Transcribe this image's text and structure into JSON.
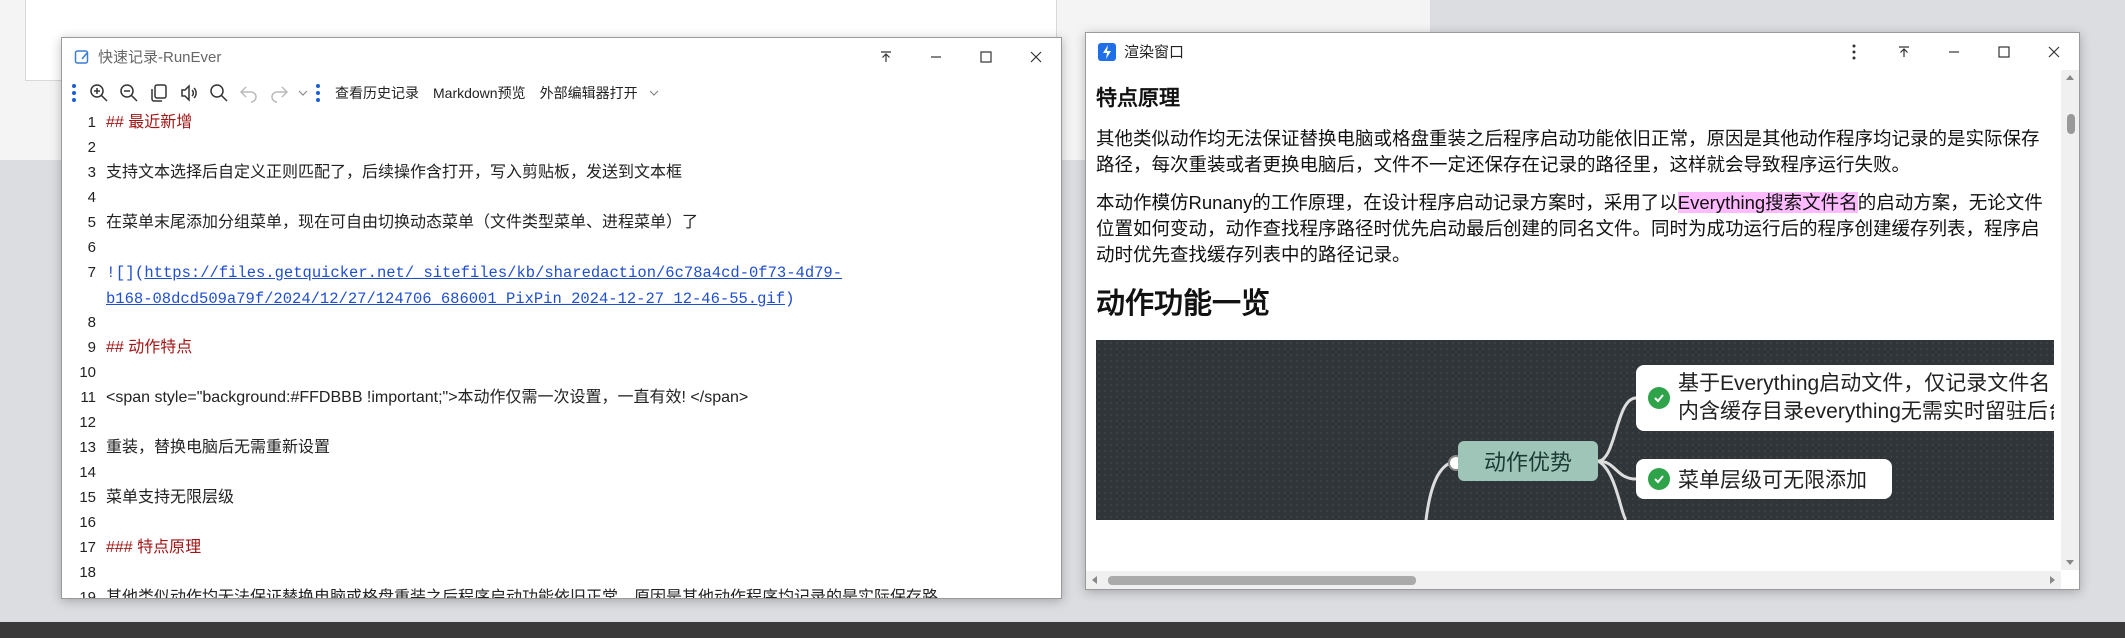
{
  "editor": {
    "title": "快速记录-RunEver",
    "toolbar": {
      "history_label": "查看历史记录",
      "preview_label": "Markdown预览",
      "external_label": "外部编辑器打开"
    },
    "lines": [
      {
        "n": "1",
        "text": "## 最近新增"
      },
      {
        "n": "2",
        "text": ""
      },
      {
        "n": "3",
        "text": "支持文本选择后自定义正则匹配了，后续操作含打开，写入剪贴板，发送到文本框"
      },
      {
        "n": "4",
        "text": ""
      },
      {
        "n": "5",
        "text": "在菜单末尾添加分组菜单，现在可自由切换动态菜单（文件类型菜单、进程菜单）了"
      },
      {
        "n": "6",
        "text": ""
      },
      {
        "n": "7",
        "prefix": "![](",
        "url1": "https://files.getquicker.net/_sitefiles/kb/sharedaction/6c78a4cd-0f73-4d79-",
        "url2": "b168-08dcd509a79f/2024/12/27/124706_686001_PixPin_2024-12-27_12-46-55.gif",
        "suffix": ")"
      },
      {
        "n": "8",
        "text": ""
      },
      {
        "n": "9",
        "text": "## 动作特点"
      },
      {
        "n": "10",
        "text": ""
      },
      {
        "n": "11",
        "text": "<span style=\"background:#FFDBBB !important;\">本动作仅需一次设置，一直有效! </span>"
      },
      {
        "n": "12",
        "text": ""
      },
      {
        "n": "13",
        "text": "重装，替换电脑后无需重新设置"
      },
      {
        "n": "14",
        "text": ""
      },
      {
        "n": "15",
        "text": "菜单支持无限层级"
      },
      {
        "n": "16",
        "text": ""
      },
      {
        "n": "17",
        "text": "### 特点原理"
      },
      {
        "n": "18",
        "text": ""
      },
      {
        "n": "19",
        "text": "其他类似动作均无法保证替换电脑或格盘重装之后程序启动功能依旧正常，原因是其他动作程序均记录的是实际保存路"
      }
    ]
  },
  "render": {
    "title": "渲染窗口",
    "h3": "特点原理",
    "p1": "其他类似动作均无法保证替换电脑或格盘重装之后程序启动功能依旧正常，原因是其他动作程序均记录的是实际保存路径，每次重装或者更换电脑后，文件不一定还保存在记录的路径里，这样就会导致程序运行失败。",
    "p2_before": "本动作模仿Runany的工作原理，在设计程序启动记录方案时，采用了以",
    "p2_highlight": "Everything搜索文件名",
    "p2_after": "的启动方案，无论文件位置如何变动，动作查找程序路径时优先启动最后创建的同名文件。同时为成功运行后的程序创建缓存列表，程序启动时优先查找缓存列表中的路径记录。",
    "h2": "动作功能一览",
    "mindmap": {
      "main": "动作优势",
      "leaf1_line1": "基于Everything启动文件，仅记录文件名",
      "leaf1_line2": "内含缓存目录everything无需实时留驻后台",
      "leaf2": "菜单层级可无限添加"
    }
  },
  "colors": {
    "heading_red": "#a31515",
    "link_blue": "#1f4fcf",
    "highlight": "#ffbbff",
    "mindmap_bg": "#2f3538",
    "mindmap_node": "#9fc4b8",
    "check_green": "#2fa34a"
  }
}
